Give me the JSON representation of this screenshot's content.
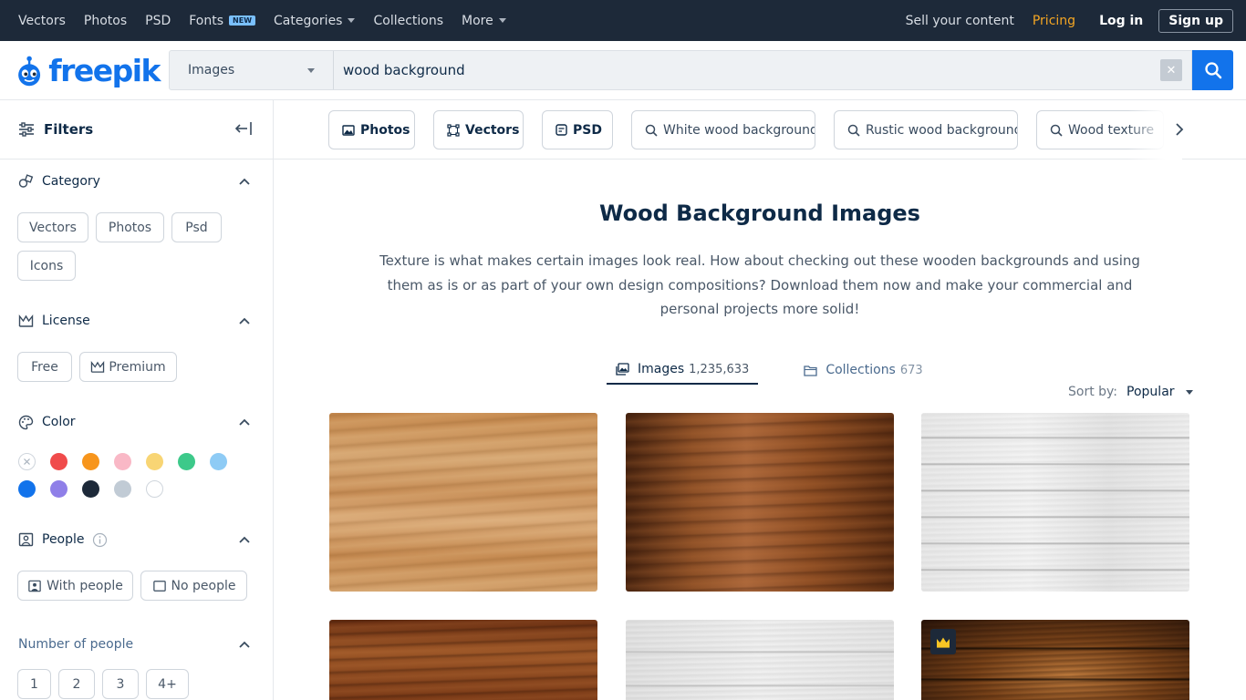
{
  "topnav": {
    "items": [
      {
        "label": "Vectors"
      },
      {
        "label": "Photos"
      },
      {
        "label": "PSD"
      },
      {
        "label": "Fonts",
        "badge": "NEW"
      },
      {
        "label": "Categories"
      },
      {
        "label": "Collections"
      },
      {
        "label": "More"
      }
    ],
    "sell": "Sell your content",
    "pricing": "Pricing",
    "login": "Log in",
    "signup": "Sign up"
  },
  "brand": {
    "name": "freepik",
    "color": "#1273eb"
  },
  "search": {
    "type": "Images",
    "query": "wood background"
  },
  "sidebar": {
    "title": "Filters",
    "category": {
      "label": "Category",
      "options": [
        "Vectors",
        "Photos",
        "Psd",
        "Icons"
      ]
    },
    "license": {
      "label": "License",
      "options": [
        "Free",
        "Premium"
      ]
    },
    "color": {
      "label": "Color",
      "swatches": [
        "none",
        "#f04b4b",
        "#f7951c",
        "#f9b8c6",
        "#f8d574",
        "#3dc98a",
        "#8ecbf5",
        "#1273eb",
        "#8f7fe8",
        "#1d2939",
        "#c1cbd5",
        "#ffffff"
      ]
    },
    "people": {
      "label": "People",
      "options": [
        "With people",
        "No people"
      ]
    },
    "number_of_people": {
      "label": "Number of people",
      "options": [
        "1",
        "2",
        "3",
        "4+"
      ]
    }
  },
  "chips": [
    {
      "label": "Photos",
      "icon": "image-icon"
    },
    {
      "label": "Vectors",
      "icon": "vector-icon"
    },
    {
      "label": "PSD",
      "icon": "psd-icon"
    },
    {
      "label": "White wood background",
      "icon": "search-icon"
    },
    {
      "label": "Rustic wood background",
      "icon": "search-icon"
    },
    {
      "label": "Wood texture",
      "icon": "search-icon"
    }
  ],
  "page": {
    "title": "Wood Background Images",
    "description": "Texture is what makes certain images look real. How about checking out these wooden backgrounds and using them as is or as part of your own design compositions? Download them now and make your commercial and personal projects more solid!"
  },
  "tabs": [
    {
      "label": "Images",
      "count": "1,235,633"
    },
    {
      "label": "Collections",
      "count": "673"
    }
  ],
  "sort": {
    "label": "Sort by:",
    "value": "Popular"
  }
}
